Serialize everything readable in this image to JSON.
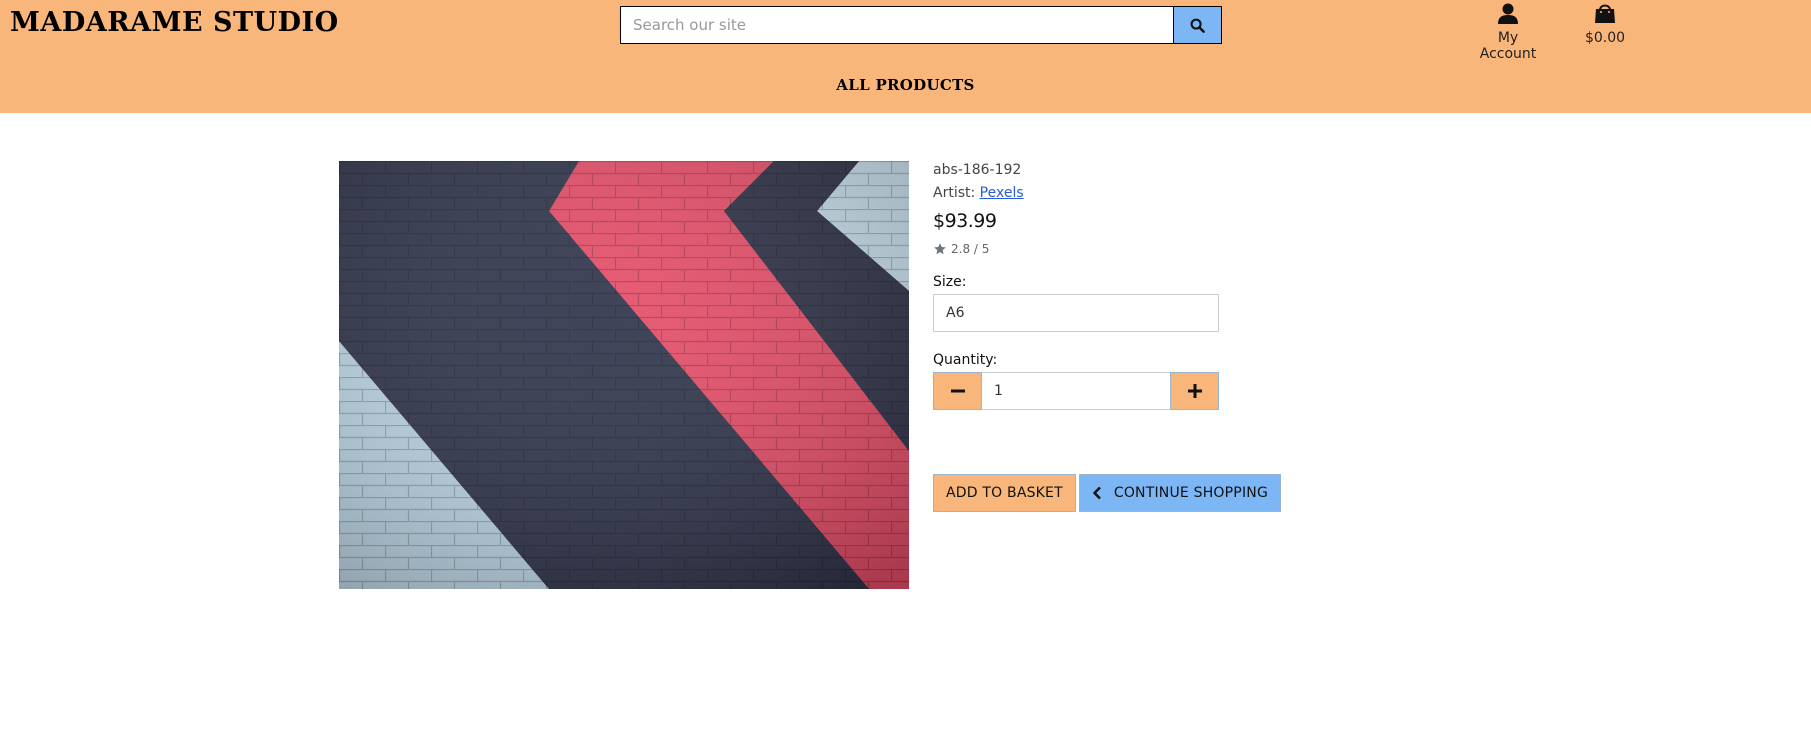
{
  "header": {
    "logo": "MADARAME STUDIO",
    "search": {
      "placeholder": "Search our site",
      "value": ""
    },
    "account_label": "My Account",
    "basket_total": "$0.00",
    "nav_link": "ALL PRODUCTS",
    "background": "#f8b67a"
  },
  "product": {
    "sku": "abs-186-192",
    "artist_prefix": "Artist:",
    "artist_name": "Pexels",
    "price": "$93.99",
    "rating": "2.8 / 5",
    "size_label": "Size:",
    "size_value": "A6",
    "quantity_label": "Quantity:",
    "quantity_value": "1"
  },
  "buttons": {
    "add_to_basket": "ADD TO BASKET",
    "continue_shopping": "CONTINUE SHOPPING"
  },
  "icons": {
    "search": "search-icon",
    "account": "user-icon",
    "basket": "shopping-bag-icon",
    "rating": "star-icon",
    "minus": "minus-icon",
    "plus": "plus-icon",
    "back": "chevron-left-icon"
  },
  "colors": {
    "accent_orange": "#f8b67a",
    "accent_blue": "#7cb6f4",
    "link": "#2a5bd7"
  }
}
